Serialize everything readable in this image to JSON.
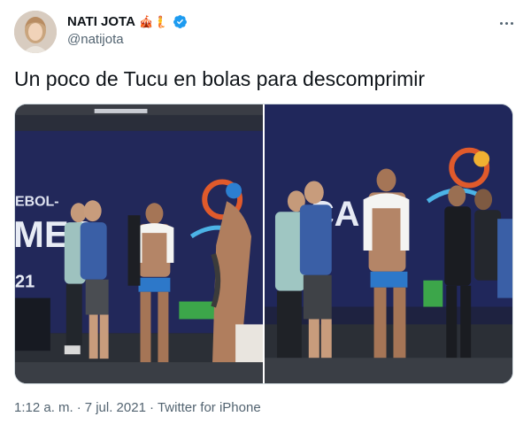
{
  "tweet": {
    "author": {
      "display_name": "NATI JOTA",
      "name_emojis": "🎪🧜",
      "handle": "@natijota",
      "verified": true,
      "avatar_icon": "profile-photo"
    },
    "text": "Un poco de Tucu en bolas para descomprimir",
    "media": {
      "count": 2,
      "photos": [
        {
          "icon": "locker-room-photo",
          "banner_text": "EBOL-\nMEC\n21"
        },
        {
          "icon": "locker-room-photo",
          "banner_text": "CA"
        }
      ]
    },
    "timestamp": {
      "time": "1:12 a. m.",
      "separator": "·",
      "date": "7 jul. 2021",
      "source": "Twitter for iPhone"
    }
  },
  "colors": {
    "text_primary": "#0f1419",
    "text_secondary": "#536471",
    "verified_blue": "#1d9bf0",
    "border": "#cfd9de"
  }
}
